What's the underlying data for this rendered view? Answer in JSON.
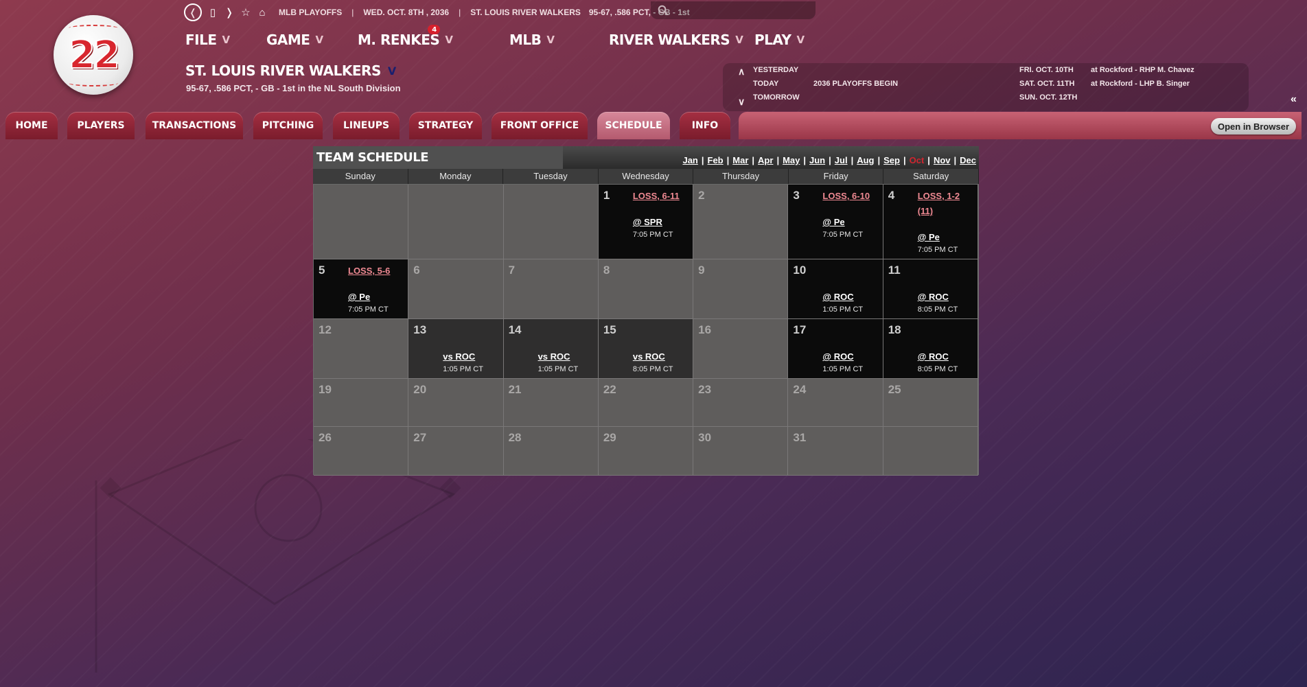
{
  "logo": {
    "number": "22"
  },
  "top_strip": {
    "league": "MLB PLAYOFFS",
    "date": "WED. OCT. 8TH , 2036",
    "team": "ST. LOUIS RIVER WALKERS",
    "record": "95-67, .586 PCT, - GB - 1st"
  },
  "menu": {
    "file": "FILE",
    "game": "GAME",
    "manager": "M. RENKES",
    "manager_badge": "4",
    "mlb": "MLB",
    "team": "RIVER WALKERS",
    "play": "PLAY"
  },
  "team": {
    "name": "ST. LOUIS RIVER WALKERS",
    "record": "95-67, .586 PCT, - GB - 1st in the NL South Division"
  },
  "mini_schedule": {
    "yesterday": "YESTERDAY",
    "today": "TODAY",
    "today_event": "2036 PLAYOFFS BEGIN",
    "tomorrow": "TOMORROW",
    "upcoming": [
      {
        "date": "FRI. OCT. 10TH",
        "game": "at Rockford - RHP M. Chavez"
      },
      {
        "date": "SAT. OCT. 11TH",
        "game": "at Rockford - LHP B. Singer"
      },
      {
        "date": "SUN. OCT. 12TH",
        "game": ""
      }
    ]
  },
  "tabs": {
    "home": "HOME",
    "players": "PLAYERS",
    "transactions": "TRANSACTIONS",
    "pitching": "PITCHING",
    "lineups": "LINEUPS",
    "strategy": "STRATEGY",
    "front_office": "FRONT OFFICE",
    "schedule": "SCHEDULE",
    "info": "INFO",
    "active": "SCHEDULE"
  },
  "open_in_browser": "Open in Browser",
  "calendar": {
    "title": "TEAM SCHEDULE",
    "months": [
      "Jan",
      "Feb",
      "Mar",
      "Apr",
      "May",
      "Jun",
      "Jul",
      "Aug",
      "Sep",
      "Oct",
      "Nov",
      "Dec"
    ],
    "current_month": "Oct",
    "weekdays": [
      "Sunday",
      "Monday",
      "Tuesday",
      "Wednesday",
      "Thursday",
      "Friday",
      "Saturday"
    ],
    "days": {
      "d1": {
        "num": "1",
        "result": "LOSS, 6-11",
        "opp": "@ SPR",
        "time": "7:05 PM CT"
      },
      "d2": {
        "num": "2"
      },
      "d3": {
        "num": "3",
        "result": "LOSS, 6-10",
        "opp": "@ Pe",
        "time": "7:05 PM CT"
      },
      "d4": {
        "num": "4",
        "result": "LOSS, 1-2 (11)",
        "opp": "@ Pe",
        "time": "7:05 PM CT"
      },
      "d5": {
        "num": "5",
        "result": "LOSS, 5-6",
        "opp": "@ Pe",
        "time": "7:05 PM CT"
      },
      "d6": {
        "num": "6"
      },
      "d7": {
        "num": "7"
      },
      "d8": {
        "num": "8"
      },
      "d9": {
        "num": "9"
      },
      "d10": {
        "num": "10",
        "opp": "@ ROC",
        "time": "1:05 PM CT"
      },
      "d11": {
        "num": "11",
        "opp": "@ ROC",
        "time": "8:05 PM CT"
      },
      "d12": {
        "num": "12"
      },
      "d13": {
        "num": "13",
        "opp": "vs ROC",
        "time": "1:05 PM CT"
      },
      "d14": {
        "num": "14",
        "opp": "vs ROC",
        "time": "1:05 PM CT"
      },
      "d15": {
        "num": "15",
        "opp": "vs ROC",
        "time": "8:05 PM CT"
      },
      "d16": {
        "num": "16"
      },
      "d17": {
        "num": "17",
        "opp": "@ ROC",
        "time": "1:05 PM CT"
      },
      "d18": {
        "num": "18",
        "opp": "@ ROC",
        "time": "8:05 PM CT"
      },
      "d19": {
        "num": "19"
      },
      "d20": {
        "num": "20"
      },
      "d21": {
        "num": "21"
      },
      "d22": {
        "num": "22"
      },
      "d23": {
        "num": "23"
      },
      "d24": {
        "num": "24"
      },
      "d25": {
        "num": "25"
      },
      "d26": {
        "num": "26"
      },
      "d27": {
        "num": "27"
      },
      "d28": {
        "num": "28"
      },
      "d29": {
        "num": "29"
      },
      "d30": {
        "num": "30"
      },
      "d31": {
        "num": "31"
      }
    }
  },
  "colors": {
    "accent_red": "#d1252f",
    "loss_text": "#f08a93",
    "tab_active": "#d7889a"
  }
}
